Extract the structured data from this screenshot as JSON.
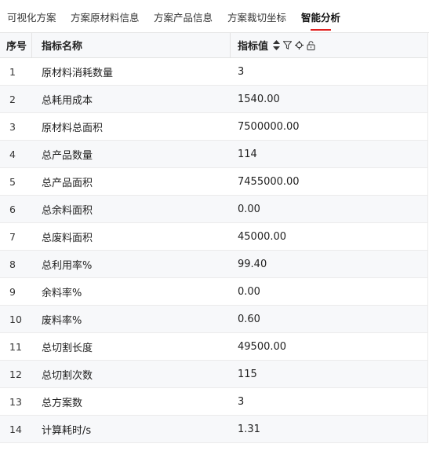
{
  "tabs": [
    {
      "label": "可视化方案",
      "active": false
    },
    {
      "label": "方案原材料信息",
      "active": false
    },
    {
      "label": "方案产品信息",
      "active": false
    },
    {
      "label": "方案裁切坐标",
      "active": false
    },
    {
      "label": "智能分析",
      "active": true
    }
  ],
  "table": {
    "headers": {
      "index": "序号",
      "name": "指标名称",
      "value": "指标值"
    },
    "header_icons": [
      "sort-icon",
      "filter-icon",
      "settings-icon",
      "lock-icon"
    ],
    "rows": [
      {
        "index": "1",
        "name": "原材料消耗数量",
        "value": "3"
      },
      {
        "index": "2",
        "name": "总耗用成本",
        "value": "1540.00"
      },
      {
        "index": "3",
        "name": "原材料总面积",
        "value": "7500000.00"
      },
      {
        "index": "4",
        "name": "总产品数量",
        "value": "114"
      },
      {
        "index": "5",
        "name": "总产品面积",
        "value": "7455000.00"
      },
      {
        "index": "6",
        "name": "总余料面积",
        "value": "0.00"
      },
      {
        "index": "7",
        "name": "总废料面积",
        "value": "45000.00"
      },
      {
        "index": "8",
        "name": "总利用率%",
        "value": "99.40"
      },
      {
        "index": "9",
        "name": "余料率%",
        "value": "0.00"
      },
      {
        "index": "10",
        "name": "废料率%",
        "value": "0.60"
      },
      {
        "index": "11",
        "name": "总切割长度",
        "value": "49500.00"
      },
      {
        "index": "12",
        "name": "总切割次数",
        "value": "115"
      },
      {
        "index": "13",
        "name": "总方案数",
        "value": "3"
      },
      {
        "index": "14",
        "name": "计算耗时/s",
        "value": "1.31"
      }
    ]
  },
  "colors": {
    "active_tab_underline": "#e0201f",
    "alt_row": "#f7f8fa"
  }
}
